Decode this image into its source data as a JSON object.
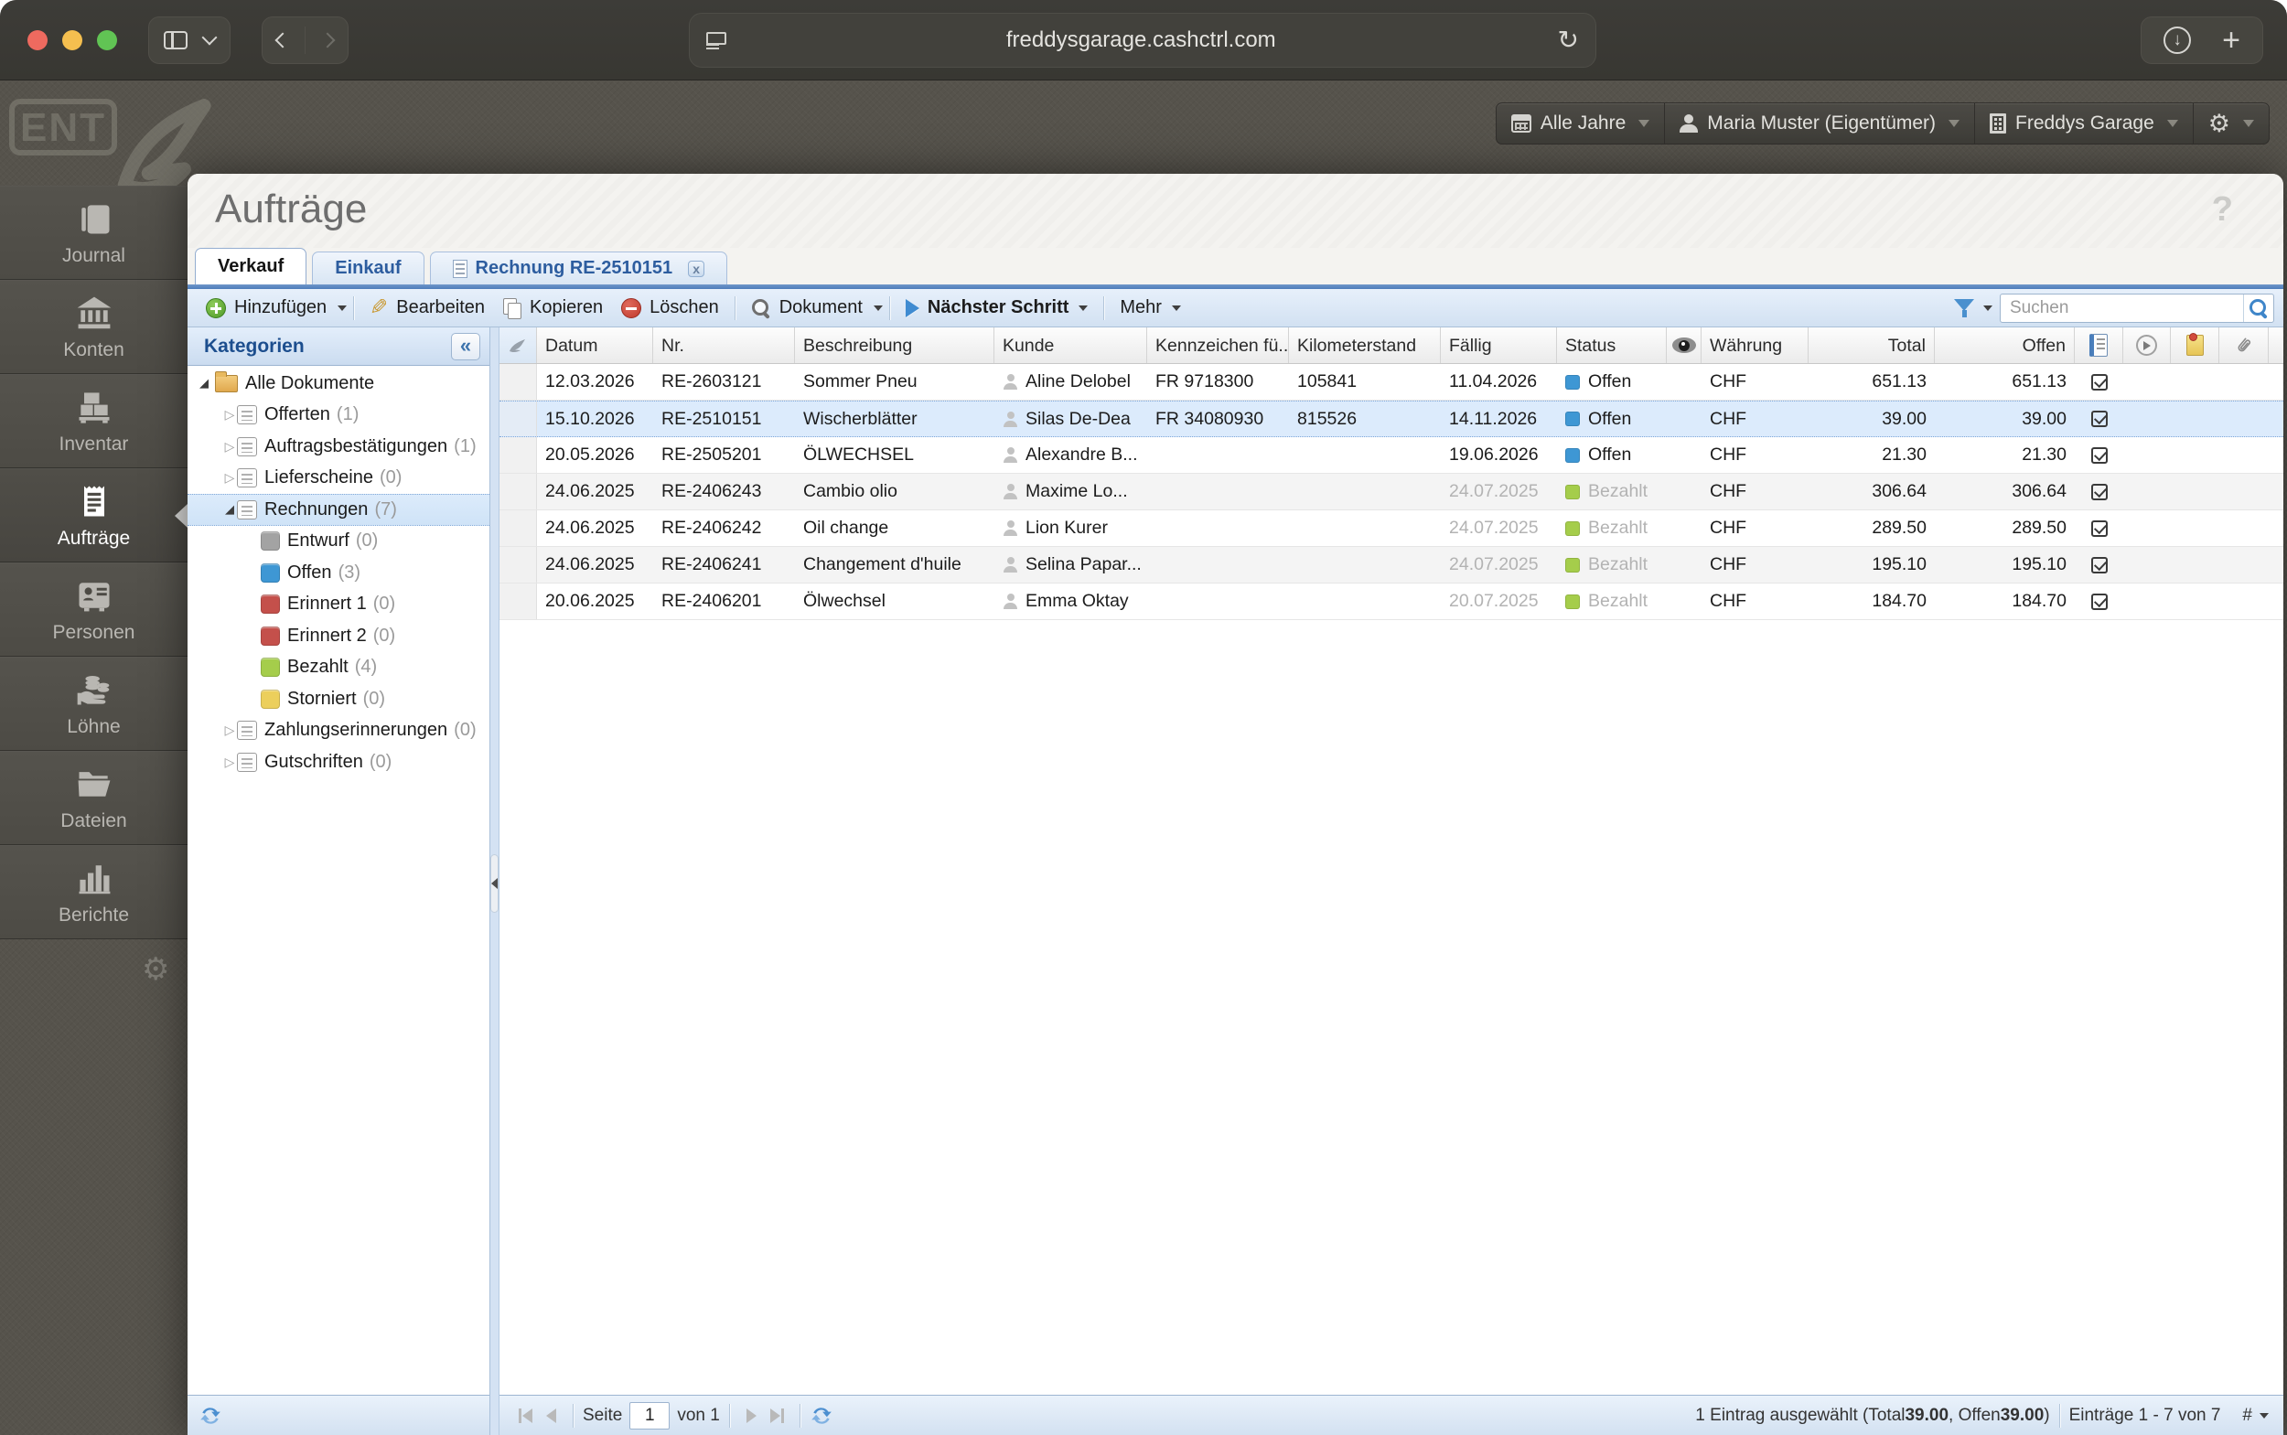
{
  "browser": {
    "url": "freddysgarage.cashctrl.com"
  },
  "app_header": {
    "year_filter": "Alle Jahre",
    "user": "Maria Muster (Eigentümer)",
    "company": "Freddys Garage"
  },
  "page": {
    "title": "Aufträge",
    "help_glyph": "?"
  },
  "nav": {
    "logo_text": "ENT",
    "items": [
      {
        "label": "Journal"
      },
      {
        "label": "Konten"
      },
      {
        "label": "Inventar"
      },
      {
        "label": "Aufträge"
      },
      {
        "label": "Personen"
      },
      {
        "label": "Löhne"
      },
      {
        "label": "Dateien"
      },
      {
        "label": "Berichte"
      }
    ]
  },
  "tabs": {
    "verkauf": "Verkauf",
    "einkauf": "Einkauf",
    "rechnung": "Rechnung RE-2510151",
    "close_glyph": "x"
  },
  "toolbar": {
    "add": "Hinzufügen",
    "edit": "Bearbeiten",
    "copy": "Kopieren",
    "delete": "Löschen",
    "document": "Dokument",
    "next_step": "Nächster Schritt",
    "more": "Mehr",
    "search_placeholder": "Suchen"
  },
  "categories": {
    "title": "Kategorien",
    "collapse_glyph": "«",
    "items": [
      {
        "label": "Alle Dokumente",
        "count": ""
      },
      {
        "label": "Offerten",
        "count": "(1)"
      },
      {
        "label": "Auftragsbestätigungen",
        "count": "(1)"
      },
      {
        "label": "Lieferscheine",
        "count": "(0)"
      },
      {
        "label": "Rechnungen",
        "count": "(7)"
      },
      {
        "label": "Entwurf",
        "count": "(0)"
      },
      {
        "label": "Offen",
        "count": "(3)"
      },
      {
        "label": "Erinnert 1",
        "count": "(0)"
      },
      {
        "label": "Erinnert 2",
        "count": "(0)"
      },
      {
        "label": "Bezahlt",
        "count": "(4)"
      },
      {
        "label": "Storniert",
        "count": "(0)"
      },
      {
        "label": "Zahlungserinnerungen",
        "count": "(0)"
      },
      {
        "label": "Gutschriften",
        "count": "(0)"
      }
    ]
  },
  "grid": {
    "columns": {
      "datum": "Datum",
      "nr": "Nr.",
      "beschreibung": "Beschreibung",
      "kunde": "Kunde",
      "kennzeichen": "Kennzeichen fü...",
      "km": "Kilometerstand",
      "faellig": "Fällig",
      "status": "Status",
      "waehrung": "Währung",
      "total": "Total",
      "offen": "Offen"
    },
    "rows": [
      {
        "datum": "12.03.2026",
        "nr": "RE-2603121",
        "beschreibung": "Sommer Pneu",
        "kunde": "Aline Delobel",
        "kennzeichen": "FR 9718300",
        "km": "105841",
        "faellig": "11.04.2026",
        "status": "Offen",
        "status_key": "offen",
        "waehrung": "CHF",
        "total": "651.13",
        "offen": "651.13"
      },
      {
        "datum": "15.10.2026",
        "nr": "RE-2510151",
        "beschreibung": "Wischerblätter",
        "kunde": "Silas De-Dea",
        "kennzeichen": "FR 34080930",
        "km": "815526",
        "faellig": "14.11.2026",
        "status": "Offen",
        "status_key": "offen",
        "waehrung": "CHF",
        "total": "39.00",
        "offen": "39.00"
      },
      {
        "datum": "20.05.2026",
        "nr": "RE-2505201",
        "beschreibung": "ÖLWECHSEL",
        "kunde": "Alexandre B...",
        "kennzeichen": "",
        "km": "",
        "faellig": "19.06.2026",
        "status": "Offen",
        "status_key": "offen",
        "waehrung": "CHF",
        "total": "21.30",
        "offen": "21.30"
      },
      {
        "datum": "24.06.2025",
        "nr": "RE-2406243",
        "beschreibung": "Cambio olio",
        "kunde": "Maxime Lo...",
        "kennzeichen": "",
        "km": "",
        "faellig": "24.07.2025",
        "status": "Bezahlt",
        "status_key": "bezahlt",
        "waehrung": "CHF",
        "total": "306.64",
        "offen": "306.64"
      },
      {
        "datum": "24.06.2025",
        "nr": "RE-2406242",
        "beschreibung": "Oil change",
        "kunde": "Lion Kurer",
        "kennzeichen": "",
        "km": "",
        "faellig": "24.07.2025",
        "status": "Bezahlt",
        "status_key": "bezahlt",
        "waehrung": "CHF",
        "total": "289.50",
        "offen": "289.50"
      },
      {
        "datum": "24.06.2025",
        "nr": "RE-2406241",
        "beschreibung": "Changement d'huile",
        "kunde": "Selina Papar...",
        "kennzeichen": "",
        "km": "",
        "faellig": "24.07.2025",
        "status": "Bezahlt",
        "status_key": "bezahlt",
        "waehrung": "CHF",
        "total": "195.10",
        "offen": "195.10"
      },
      {
        "datum": "20.06.2025",
        "nr": "RE-2406201",
        "beschreibung": "Ölwechsel",
        "kunde": "Emma Oktay",
        "kennzeichen": "",
        "km": "",
        "faellig": "20.07.2025",
        "status": "Bezahlt",
        "status_key": "bezahlt",
        "waehrung": "CHF",
        "total": "184.70",
        "offen": "184.70"
      }
    ],
    "pager": {
      "seite": "Seite",
      "page_value": "1",
      "von": "von 1"
    }
  },
  "statusbar": {
    "sel_prefix": "1 Eintrag ausgewählt (Total ",
    "sel_total": "39.00",
    "sel_mid": ", Offen ",
    "sel_offen": "39.00",
    "sel_suffix": ")",
    "entries": "Einträge 1 - 7 von 7",
    "hash": "#"
  },
  "colors": {
    "status_offen": "#3e97d4",
    "status_bezahlt": "#a5cd4b",
    "status_erinnert": "#c4504b",
    "status_storniert": "#eccf5c",
    "status_entwurf": "#a3a3a3",
    "selection_bg": "#dcebfc",
    "toolbar_blue": "#4d7cba",
    "header_bar_blue": "#1c4e8e"
  }
}
